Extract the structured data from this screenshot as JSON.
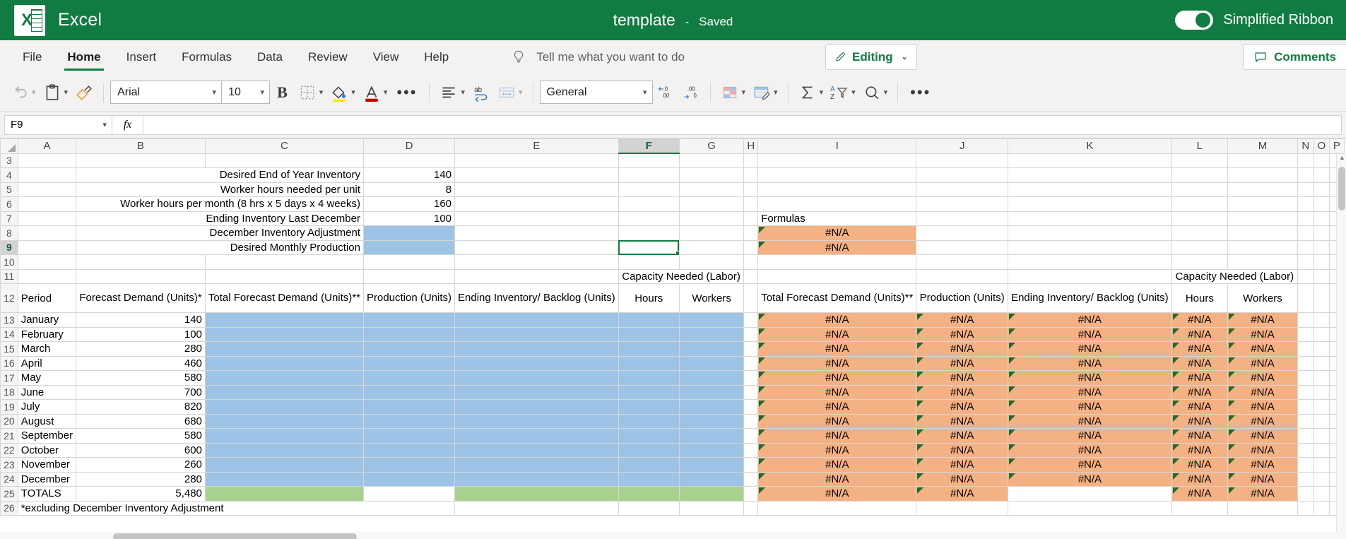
{
  "titlebar": {
    "app_name": "Excel",
    "logo_letter": "X",
    "doc_title": "template",
    "separator": "-",
    "save_state": "Saved",
    "ribbon_toggle_label": "Simplified Ribbon"
  },
  "tabs": [
    {
      "label": "File",
      "active": false
    },
    {
      "label": "Home",
      "active": true
    },
    {
      "label": "Insert",
      "active": false
    },
    {
      "label": "Formulas",
      "active": false
    },
    {
      "label": "Data",
      "active": false
    },
    {
      "label": "Review",
      "active": false
    },
    {
      "label": "View",
      "active": false
    },
    {
      "label": "Help",
      "active": false
    }
  ],
  "tellme": {
    "placeholder": "Tell me what you want to do"
  },
  "editing_button": {
    "label": "Editing",
    "chevron": "⌄"
  },
  "comments_button": {
    "label": "Comments"
  },
  "toolbar": {
    "undo": "undo-icon",
    "paste": "paste-icon",
    "format_painter": "format-painter-icon",
    "font_name": "Arial",
    "font_size": "10",
    "bold": "B",
    "borders": "borders-icon",
    "fill_color": "fill-color-icon",
    "font_color": "font-color-icon",
    "more_font": "•••",
    "align": "align-icon",
    "wrap_text": "wrap-text-icon",
    "merge": "merge-cells-icon",
    "number_format": "General",
    "increase_decimal": ".00",
    "decrease_decimal": ".00",
    "conditional_formatting": "conditional-formatting-icon",
    "format_as_table": "format-as-table-icon",
    "autosum": "∑",
    "sort_filter": "sort-filter-icon",
    "find": "find-icon",
    "more": "•••"
  },
  "formula_bar": {
    "name_box": "F9",
    "fx": "fx",
    "formula": ""
  },
  "grid": {
    "columns": [
      "A",
      "B",
      "C",
      "D",
      "E",
      "F",
      "G",
      "H",
      "I",
      "J",
      "K",
      "L",
      "M",
      "N",
      "O",
      "P"
    ],
    "selected_column": "F",
    "selected_row": "9",
    "rows": [
      "3",
      "4",
      "5",
      "6",
      "7",
      "8",
      "9",
      "10",
      "11",
      "12",
      "13",
      "14",
      "15",
      "16",
      "17",
      "18",
      "19",
      "20",
      "21",
      "22",
      "23",
      "24",
      "25",
      "26"
    ],
    "params": [
      {
        "row": "4",
        "label": "Desired End of Year Inventory",
        "value": "140"
      },
      {
        "row": "5",
        "label": "Worker hours needed per unit",
        "value": "8"
      },
      {
        "row": "6",
        "label": "Worker hours per month (8 hrs x 5 days x 4 weeks)",
        "value": "160"
      },
      {
        "row": "7",
        "label": "Ending Inventory Last December",
        "value": "100"
      },
      {
        "row": "8",
        "label": "December Inventory Adjustment",
        "value": ""
      },
      {
        "row": "9",
        "label": "Desired Monthly Production",
        "value": ""
      }
    ],
    "formulas_header": "Formulas",
    "formulas_values": [
      "#N/A",
      "#N/A"
    ],
    "group_header": "Capacity Needed (Labor)",
    "headers_left": [
      "Period",
      "Forecast Demand\n(Units)*",
      "Total Forecast\nDemand (Units)**",
      "Production (Units)",
      "Ending Inventory/\nBacklog (Units)",
      "Hours",
      "Workers"
    ],
    "headers_right": [
      "Total Forecast\nDemand (Units)**",
      "Production (Units)",
      "Ending Inventory/\nBacklog (Units)",
      "Hours",
      "Workers"
    ],
    "periods": [
      "January",
      "February",
      "March",
      "April",
      "May",
      "June",
      "July",
      "August",
      "September",
      "October",
      "November",
      "December"
    ],
    "forecast_demand": [
      "140",
      "100",
      "280",
      "460",
      "580",
      "700",
      "820",
      "680",
      "580",
      "600",
      "260",
      "280"
    ],
    "totals_label": "TOTALS",
    "totals_forecast": "5,480",
    "na": "#N/A",
    "footnote": "*excluding December Inventory Adjustment"
  },
  "colors": {
    "brand_green": "#107C41",
    "input_blue": "#9DC3E6",
    "totals_green": "#A9D18E",
    "error_orange": "#F4B183"
  }
}
